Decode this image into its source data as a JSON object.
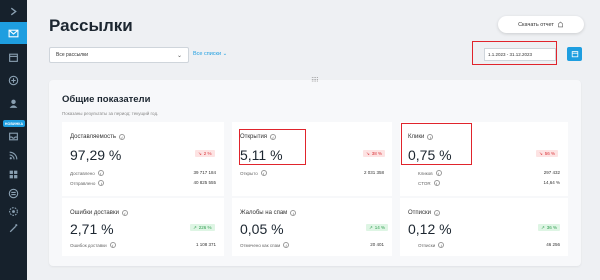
{
  "sidebar": {
    "items": [
      "chevron-right",
      "mail",
      "calendar",
      "plus-circle",
      "user",
      "inbox",
      "rss",
      "grid",
      "stack",
      "shield-gear",
      "magic-wand"
    ],
    "active_index": 1,
    "badge": "НОВИНКА"
  },
  "header": {
    "title": "Рассылки",
    "export_label": "Скачать отчет"
  },
  "filters": {
    "mailings_select": "Все рассылки",
    "all_lists": "Все списки",
    "date_range": "1.1.2023 - 31.12.2023"
  },
  "panel": {
    "title": "Общие показатели",
    "subtitle": "Показаны результаты за период: текущий год."
  },
  "cards": {
    "deliverability": {
      "name": "Доставляемость",
      "value": "97,29 %",
      "delta": "2 %",
      "rows": [
        {
          "label": "Доставлено",
          "value": "39 717 184"
        },
        {
          "label": "Отправлено",
          "value": "40 825 555"
        }
      ]
    },
    "opens": {
      "name": "Открытия",
      "value": "5,11 %",
      "delta": "38 %",
      "rows": [
        {
          "label": "Открыто",
          "value": "2 031 358"
        }
      ]
    },
    "clicks": {
      "name": "Клики",
      "value": "0,75 %",
      "delta": "56 %",
      "rows": [
        {
          "label": "Кликов",
          "value": "297 432"
        },
        {
          "label": "CTOR",
          "value": "14,64 %"
        }
      ]
    },
    "delivery_errors": {
      "name": "Ошибки доставки",
      "value": "2,71 %",
      "delta": "226 %",
      "rows": [
        {
          "label": "Ошибок доставки",
          "value": "1 108 371"
        }
      ]
    },
    "spam": {
      "name": "Жалобы на спам",
      "value": "0,05 %",
      "delta": "14 %",
      "rows": [
        {
          "label": "Отмечено как спам",
          "value": "20 401"
        }
      ]
    },
    "unsubscribes": {
      "name": "Отписки",
      "value": "0,12 %",
      "delta": "36 %",
      "rows": [
        {
          "label": "Отписки",
          "value": "46 256"
        }
      ]
    }
  },
  "colors": {
    "accent": "#1e9ee0",
    "sidebar_bg": "#16212c",
    "highlight": "#e0242c",
    "negative": "#d9343a",
    "positive": "#2c9c4d"
  }
}
